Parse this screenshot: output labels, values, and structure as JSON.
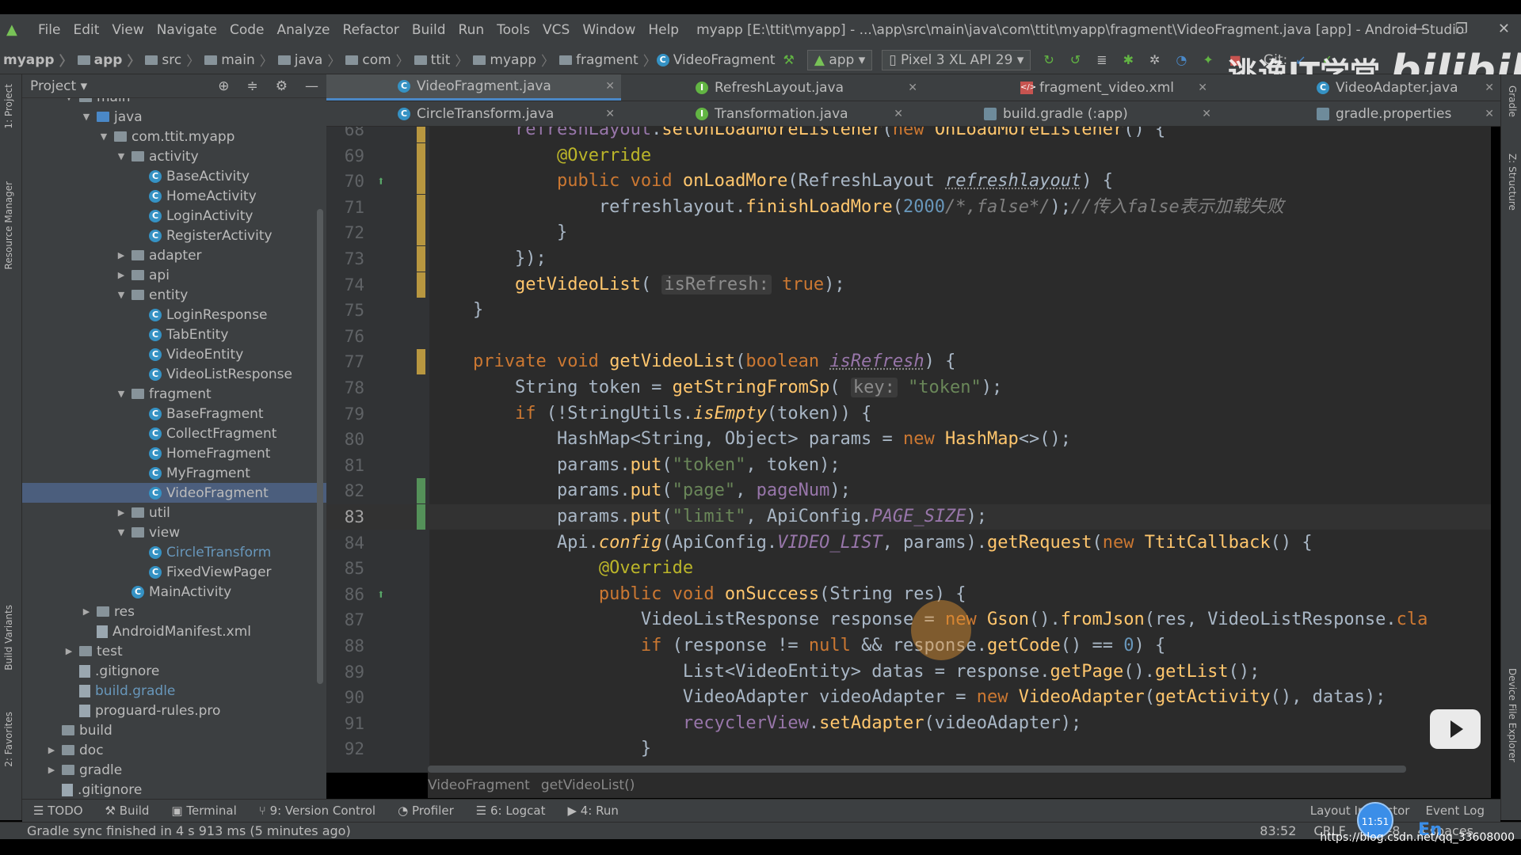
{
  "window": {
    "title": "myapp [E:\\ttit\\myapp] - ...\\app\\src\\main\\java\\com\\ttit\\myapp\\fragment\\VideoFragment.java [app] - Android Studio",
    "menu": [
      "File",
      "Edit",
      "View",
      "Navigate",
      "Code",
      "Analyze",
      "Refactor",
      "Build",
      "Run",
      "Tools",
      "VCS",
      "Window",
      "Help"
    ]
  },
  "breadcrumb": [
    "myapp",
    "app",
    "src",
    "main",
    "java",
    "com",
    "ttit",
    "myapp",
    "fragment",
    "VideoFragment"
  ],
  "toolbar": {
    "run_config": "app",
    "device": "Pixel 3 XL API 29",
    "git_label": "Git:"
  },
  "project_panel": {
    "title": "Project",
    "tree": [
      {
        "label": "main",
        "type": "folder",
        "indent": 0,
        "arrow": "▼"
      },
      {
        "label": "java",
        "type": "folder-blue",
        "indent": 1,
        "arrow": "▼"
      },
      {
        "label": "com.ttit.myapp",
        "type": "folder",
        "indent": 2,
        "arrow": "▼"
      },
      {
        "label": "activity",
        "type": "folder",
        "indent": 3,
        "arrow": "▼"
      },
      {
        "label": "BaseActivity",
        "type": "class",
        "indent": 4
      },
      {
        "label": "HomeActivity",
        "type": "class",
        "indent": 4
      },
      {
        "label": "LoginActivity",
        "type": "class",
        "indent": 4
      },
      {
        "label": "RegisterActivity",
        "type": "class",
        "indent": 4
      },
      {
        "label": "adapter",
        "type": "folder",
        "indent": 3,
        "arrow": "▶"
      },
      {
        "label": "api",
        "type": "folder",
        "indent": 3,
        "arrow": "▶"
      },
      {
        "label": "entity",
        "type": "folder",
        "indent": 3,
        "arrow": "▼"
      },
      {
        "label": "LoginResponse",
        "type": "class",
        "indent": 4
      },
      {
        "label": "TabEntity",
        "type": "class",
        "indent": 4
      },
      {
        "label": "VideoEntity",
        "type": "class",
        "indent": 4
      },
      {
        "label": "VideoListResponse",
        "type": "class",
        "indent": 4
      },
      {
        "label": "fragment",
        "type": "folder",
        "indent": 3,
        "arrow": "▼"
      },
      {
        "label": "BaseFragment",
        "type": "class",
        "indent": 4
      },
      {
        "label": "CollectFragment",
        "type": "class",
        "indent": 4
      },
      {
        "label": "HomeFragment",
        "type": "class",
        "indent": 4
      },
      {
        "label": "MyFragment",
        "type": "class",
        "indent": 4
      },
      {
        "label": "VideoFragment",
        "type": "class",
        "indent": 4,
        "selected": true
      },
      {
        "label": "util",
        "type": "folder",
        "indent": 3,
        "arrow": "▶"
      },
      {
        "label": "view",
        "type": "folder",
        "indent": 3,
        "arrow": "▼"
      },
      {
        "label": "CircleTransform",
        "type": "class",
        "indent": 4,
        "highlight": true
      },
      {
        "label": "FixedViewPager",
        "type": "class",
        "indent": 4
      },
      {
        "label": "MainActivity",
        "type": "class",
        "indent": 3
      },
      {
        "label": "res",
        "type": "folder",
        "indent": 1,
        "arrow": "▶"
      },
      {
        "label": "AndroidManifest.xml",
        "type": "file",
        "indent": 1
      },
      {
        "label": "test",
        "type": "folder",
        "indent": 0,
        "arrow": "▶"
      },
      {
        "label": ".gitignore",
        "type": "file",
        "indent": 0
      },
      {
        "label": "build.gradle",
        "type": "file",
        "indent": 0,
        "highlight": true
      },
      {
        "label": "proguard-rules.pro",
        "type": "file",
        "indent": 0
      },
      {
        "label": "build",
        "type": "folder",
        "indent": -1
      },
      {
        "label": "doc",
        "type": "folder",
        "indent": -1,
        "arrow": "▶"
      },
      {
        "label": "gradle",
        "type": "folder",
        "indent": -1,
        "arrow": "▶"
      },
      {
        "label": ".gitignore",
        "type": "file",
        "indent": -1
      }
    ]
  },
  "tabs_row1": [
    {
      "label": "VideoFragment.java",
      "icon": "C",
      "active": true
    },
    {
      "label": "RefreshLayout.java",
      "icon": "I"
    },
    {
      "label": "fragment_video.xml",
      "icon": "X"
    },
    {
      "label": "VideoAdapter.java",
      "icon": "C"
    }
  ],
  "tabs_row2": [
    {
      "label": "CircleTransform.java",
      "icon": "C"
    },
    {
      "label": "Transformation.java",
      "icon": "I"
    },
    {
      "label": "build.gradle (:app)",
      "icon": "G"
    },
    {
      "label": "gradle.properties",
      "icon": "G"
    }
  ],
  "code_lines": [
    {
      "n": "68",
      "html": "        <span class='fd'>refreshLayout</span>.<span class='fn'>setOnLoadMoreListener</span>(<span class='kw'>new</span> <span class='fn'>OnLoadMoreListener</span>() {"
    },
    {
      "n": "69",
      "html": "            <span class='an'>@Override</span>"
    },
    {
      "n": "70",
      "html": "            <span class='kw'>public void</span> <span class='fn'>onLoadMore</span>(RefreshLayout <span class='it errline'>refreshlayout</span>) {"
    },
    {
      "n": "71",
      "html": "                refreshlayout.<span class='fn'>finishLoadMore</span>(<span class='nm'>2000</span><span class='cm'>/*,false*/</span>);<span class='cm'>//传入false表示加载失败</span>"
    },
    {
      "n": "72",
      "html": "            }"
    },
    {
      "n": "73",
      "html": "        });"
    },
    {
      "n": "74",
      "html": "        <span class='fn'>getVideoList</span>( <span class='hint'>isRefresh:</span> <span class='kw'>true</span>);"
    },
    {
      "n": "75",
      "html": "    }"
    },
    {
      "n": "76",
      "html": ""
    },
    {
      "n": "77",
      "html": "    <span class='kw'>private void</span> <span class='fn'>getVideoList</span>(<span class='kw'>boolean</span> <span class='it errline pu'>isRefresh</span>) {"
    },
    {
      "n": "78",
      "html": "        String token = <span class='fn'>getStringFromSp</span>( <span class='hint'>key:</span> <span class='st'>\"token\"</span>);"
    },
    {
      "n": "79",
      "html": "        <span class='kw'>if</span> (!StringUtils.<span class='fn it'>isEmpty</span>(token)) {"
    },
    {
      "n": "80",
      "html": "            HashMap&lt;String, Object&gt; params = <span class='kw'>new</span> <span class='fn'>HashMap</span>&lt;&gt;();"
    },
    {
      "n": "81",
      "html": "            params.<span class='fn'>put</span>(<span class='st'>\"token\"</span>, token);"
    },
    {
      "n": "82",
      "html": "            params.<span class='fn'>put</span>(<span class='st'>\"page\"</span>, <span class='fd'>pageNum</span>);"
    },
    {
      "n": "83",
      "html": "            params.<span class='fn'>put</span>(<span class='st'>\"limit\"</span>, ApiConfig.<span class='fd it'>PAGE_SIZE</span>);"
    },
    {
      "n": "84",
      "html": "            Api.<span class='fn it'>config</span>(ApiConfig.<span class='fd it'>VIDEO_LIST</span>, params).<span class='fn'>getRequest</span>(<span class='kw'>new</span> <span class='fn'>TtitCallback</span>() {"
    },
    {
      "n": "85",
      "html": "                <span class='an'>@Override</span>"
    },
    {
      "n": "86",
      "html": "                <span class='kw'>public void</span> <span class='fn'>onSuccess</span>(String res) {"
    },
    {
      "n": "87",
      "html": "                    VideoListResponse response = <span class='kw'>new</span> <span class='fn'>Gson</span>().<span class='fn'>fromJson</span>(res, VideoListResponse.<span class='kw'>cla</span>"
    },
    {
      "n": "88",
      "html": "                    <span class='kw'>if</span> (response != <span class='kw'>null</span> &amp;&amp; response.<span class='fn'>getCode</span>() == <span class='nm'>0</span>) {"
    },
    {
      "n": "89",
      "html": "                        List&lt;VideoEntity&gt; datas = response.<span class='fn'>getPage</span>().<span class='fn'>getList</span>();"
    },
    {
      "n": "90",
      "html": "                        VideoAdapter videoAdapter = <span class='kw'>new</span> <span class='fn'>VideoAdapter</span>(<span class='fn'>getActivity</span>(), datas);"
    },
    {
      "n": "91",
      "html": "                        <span class='fd'>recyclerView</span>.<span class='fn'>setAdapter</span>(videoAdapter);"
    },
    {
      "n": "92",
      "html": "                    }"
    }
  ],
  "editor_breadcrumb": [
    "VideoFragment",
    "getVideoList()"
  ],
  "tool_windows": [
    "TODO",
    "Build",
    "Terminal",
    "9: Version Control",
    "Profiler",
    "6: Logcat",
    "4: Run"
  ],
  "tool_windows_right": [
    "Layout Inspector",
    "Event Log"
  ],
  "status": {
    "message": "Gradle sync finished in 4 s 913 ms (5 minutes ago)",
    "position": "83:52",
    "line_sep": "CRLF",
    "encoding": "UTF-8",
    "indent": "4 spaces"
  },
  "overlay": {
    "watermark_cn": "逃逸IT学堂",
    "watermark_brand": "bilibili",
    "clock": "11:51",
    "url": "https://blog.csdn.net/qq_33608000",
    "ime": "En"
  },
  "side_tabs_left": [
    "1: Project",
    "Resource Manager",
    "Build Variants",
    "2: Favorites"
  ],
  "side_tabs_right": [
    "Gradle",
    "Z: Structure",
    "Device File Explorer"
  ]
}
